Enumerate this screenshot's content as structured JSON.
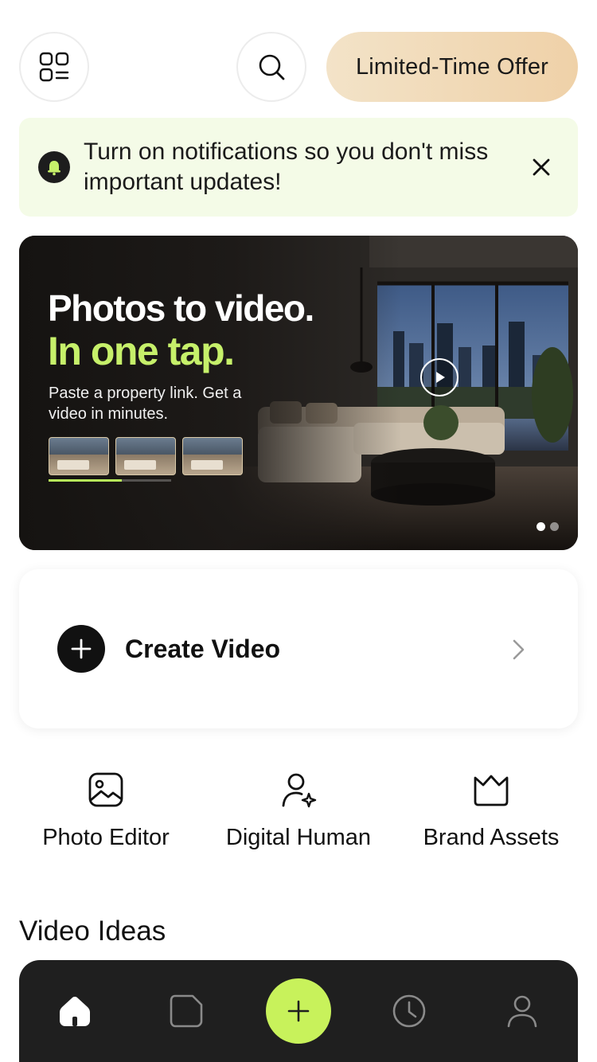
{
  "header": {
    "offer_label": "Limited-Time Offer",
    "menu_icon": "grid-menu-icon",
    "search_icon": "search-icon"
  },
  "notification": {
    "text": "Turn on notifications so you don't miss important updates!",
    "icon": "bell-icon",
    "close_icon": "close-icon",
    "bg_color": "#f4fbe7"
  },
  "banner": {
    "title_line1": "Photos to video.",
    "title_line2": "In one tap.",
    "subtitle": "Paste a property link. Get a video in minutes.",
    "accent_color": "#c6f06a",
    "slide_progress": 0.6,
    "pagination": {
      "total": 2,
      "active": 1
    }
  },
  "create": {
    "label": "Create Video"
  },
  "quick_actions": [
    {
      "label": "Photo Editor",
      "icon": "image-icon"
    },
    {
      "label": "Digital Human",
      "icon": "user-sparkle-icon"
    },
    {
      "label": "Brand Assets",
      "icon": "crown-icon"
    }
  ],
  "sections": {
    "video_ideas_title": "Video Ideas"
  },
  "tabbar": {
    "items": [
      {
        "icon": "home-icon",
        "active": true
      },
      {
        "icon": "folder-icon",
        "active": false
      },
      {
        "icon": "plus-icon",
        "active": false
      },
      {
        "icon": "clock-icon",
        "active": false
      },
      {
        "icon": "profile-icon",
        "active": false
      }
    ],
    "accent_color": "#c8f25b"
  }
}
